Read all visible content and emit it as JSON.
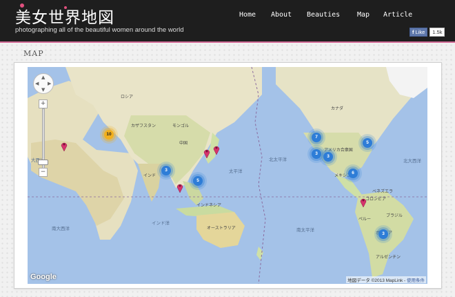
{
  "header": {
    "site_title": "美女世界地図",
    "tagline": "photographing all of the beautiful women around the world",
    "nav": [
      "Home",
      "About",
      "Beauties",
      "Map",
      "Article"
    ],
    "fb_like": {
      "label": "Like",
      "count": "1.5k",
      "icon": "facebook-f-icon"
    }
  },
  "section": {
    "title": "MAP"
  },
  "map": {
    "google_logo": "Google",
    "attribution": "地図データ ©2013 MapLink -",
    "terms_link": "使用条件",
    "zoom_controls": {
      "plus": "+",
      "minus": "−"
    },
    "clusters": [
      {
        "count": "10",
        "color": "#f2b01e"
      },
      {
        "count": "3",
        "color": "#2e7dd7"
      },
      {
        "count": "5",
        "color": "#2e7dd7"
      },
      {
        "count": "7",
        "color": "#2e7dd7"
      },
      {
        "count": "3",
        "color": "#2e7dd7"
      },
      {
        "count": "3",
        "color": "#2e7dd7"
      },
      {
        "count": "5",
        "color": "#2e7dd7"
      },
      {
        "count": "6",
        "color": "#2e7dd7"
      },
      {
        "count": "3",
        "color": "#2e7dd7"
      }
    ],
    "pin_color": "#d6336c",
    "ocean_labels": [
      "太平洋",
      "北太平洋",
      "南太平洋",
      "大西洋",
      "南大西洋",
      "インド洋",
      "北大西洋"
    ],
    "country_labels": [
      "ロシア",
      "中国",
      "モンゴル",
      "カナダ",
      "アメリカ合衆国",
      "メキシコ",
      "ブラジル",
      "オーストラリア",
      "インドネシア",
      "インド",
      "カザフスタン",
      "アルゼンチン",
      "ペルー",
      "ボリビア",
      "ベネズエラ",
      "コロンビア"
    ]
  },
  "colors": {
    "header_bg": "#1e1e1e",
    "accent": "#d26a96",
    "ocean": "#a4c2e8",
    "land": "#e7e2c9"
  }
}
